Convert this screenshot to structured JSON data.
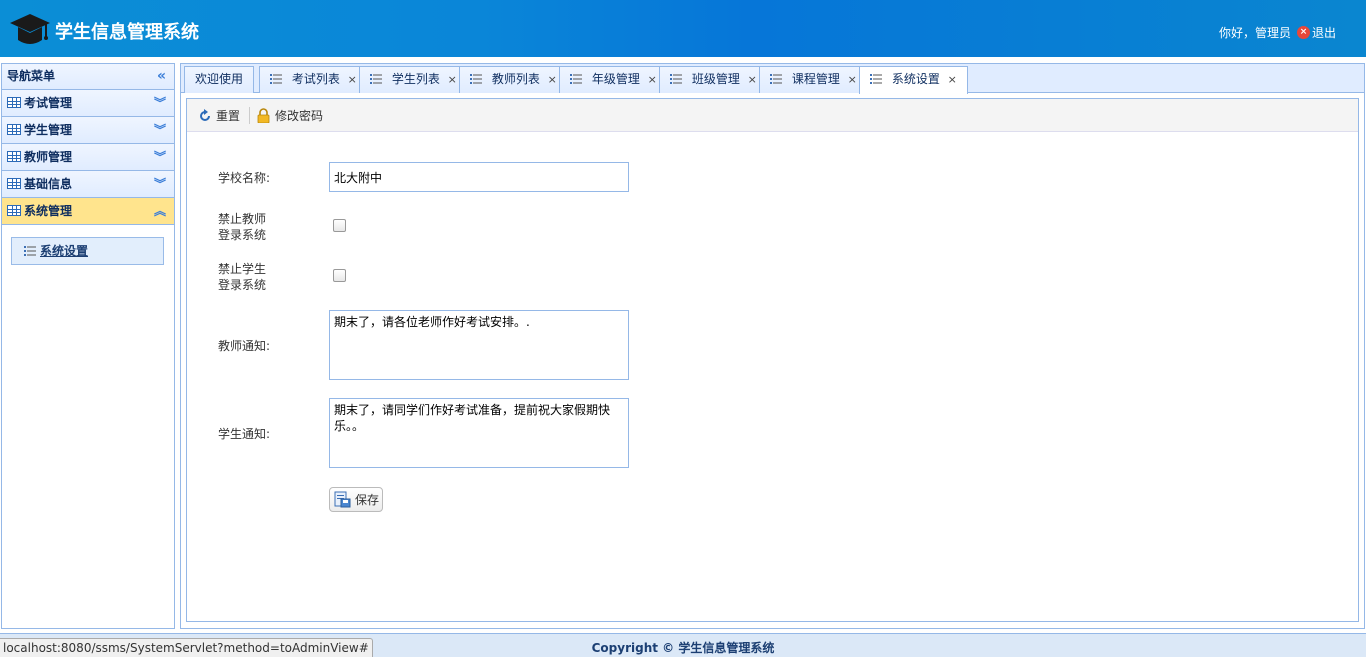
{
  "header": {
    "title": "学生信息管理系统",
    "greeting": "你好，管理员",
    "logout_label": "退出"
  },
  "sidebar": {
    "title": "导航菜单",
    "groups": [
      {
        "label": "考试管理"
      },
      {
        "label": "学生管理"
      },
      {
        "label": "教师管理"
      },
      {
        "label": "基础信息"
      },
      {
        "label": "系统管理"
      }
    ],
    "sub_item": "系统设置"
  },
  "tabs": [
    {
      "label": "欢迎使用"
    },
    {
      "label": "考试列表"
    },
    {
      "label": "学生列表"
    },
    {
      "label": "教师列表"
    },
    {
      "label": "年级管理"
    },
    {
      "label": "班级管理"
    },
    {
      "label": "课程管理"
    },
    {
      "label": "系统设置"
    }
  ],
  "toolbar": {
    "reset_label": "重置",
    "password_label": "修改密码"
  },
  "form": {
    "school_name_label": "学校名称:",
    "school_name_value": "北大附中",
    "forbid_teacher_label_1": "禁止教师",
    "forbid_teacher_label_2": "登录系统",
    "forbid_student_label_1": "禁止学生",
    "forbid_student_label_2": "登录系统",
    "teacher_notice_label": "教师通知:",
    "teacher_notice_value": "期末了，请各位老师作好考试安排。.",
    "student_notice_label": "学生通知:",
    "student_notice_value": "期末了，请同学们作好考试准备，提前祝大家假期快乐。。",
    "save_label": "保存"
  },
  "footer": {
    "copyright": "Copyright © 学生信息管理系统",
    "status_url": "localhost:8080/ssms/SystemServlet?method=toAdminView#"
  },
  "colors": {
    "header_blue": "#0a86d8",
    "border_blue": "#95b8e7",
    "active_nav": "#ffe48d"
  }
}
